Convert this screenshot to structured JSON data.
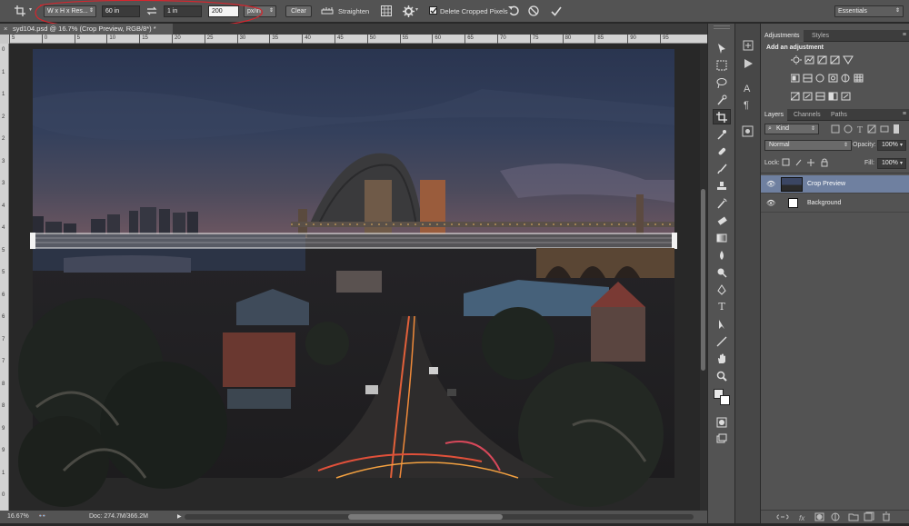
{
  "options_bar": {
    "ratio_preset": "W x H x Res...",
    "width_value": "60 in",
    "height_value": "1 in",
    "resolution_value": "200",
    "resolution_unit": "px/in",
    "clear_label": "Clear",
    "straighten_label": "Straighten",
    "delete_cropped_label": "Delete Cropped Pixels",
    "workspace": "Essentials"
  },
  "document": {
    "tab_title": "syd104.psd @ 16.7% (Crop Preview, RGB/8*) *"
  },
  "ruler": {
    "h_labels": [
      "5",
      "0",
      "5",
      "10",
      "15",
      "20",
      "25",
      "30",
      "35",
      "40",
      "45",
      "50",
      "55",
      "60",
      "65",
      "70",
      "75",
      "80",
      "85",
      "90",
      "95"
    ],
    "v_labels": [
      "0",
      "1",
      "1",
      "2",
      "2",
      "3",
      "3",
      "4",
      "4",
      "5",
      "5",
      "6",
      "6",
      "7",
      "7",
      "8",
      "8",
      "9",
      "9",
      "1",
      "0"
    ]
  },
  "status_bar": {
    "zoom": "16.67%",
    "doc_info": "Doc: 274.7M/366.2M"
  },
  "adjustments_panel": {
    "tabs": [
      "Adjustments",
      "Styles"
    ],
    "heading": "Add an adjustment"
  },
  "layers_panel": {
    "tabs": [
      "Layers",
      "Channels",
      "Paths"
    ],
    "filter_kind": "Kind",
    "blend_mode": "Normal",
    "opacity_label": "Opacity:",
    "opacity_value": "100%",
    "lock_label": "Lock:",
    "fill_label": "Fill:",
    "fill_value": "100%",
    "layers": [
      {
        "name": "Crop Preview",
        "selected": true
      },
      {
        "name": "Background",
        "selected": false
      }
    ]
  },
  "colors": {
    "ui_dark": "#535353",
    "canvas_bg": "#282828",
    "selection_blue": "#6f80a0",
    "annotation_red": "#d4262e"
  }
}
